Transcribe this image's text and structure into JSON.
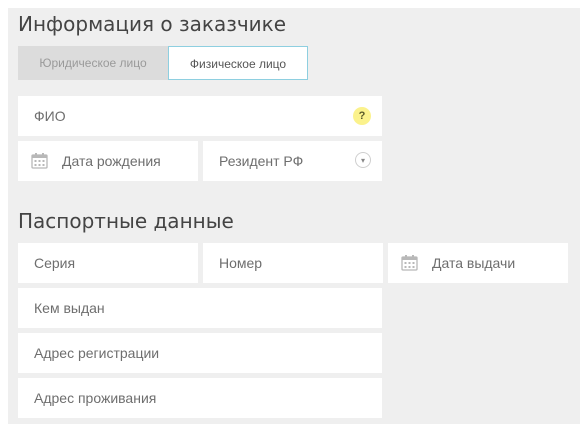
{
  "customer": {
    "title": "Информация о заказчике",
    "tabs": [
      {
        "label": "Юридическое лицо",
        "active": false
      },
      {
        "label": "Физическое лицо",
        "active": true
      }
    ],
    "full_name_placeholder": "ФИО",
    "help_glyph": "?",
    "birth_date_placeholder": "Дата рождения",
    "resident_label": "Резидент РФ",
    "dropdown_glyph": "▾"
  },
  "passport": {
    "title": "Паспортные данные",
    "series_placeholder": "Серия",
    "number_placeholder": "Номер",
    "issue_date_placeholder": "Дата выдачи",
    "issued_by_placeholder": "Кем выдан",
    "registration_address_placeholder": "Адрес регистрации",
    "residence_address_placeholder": "Адрес проживания"
  },
  "icons": {
    "calendar": "calendar-icon",
    "help": "help-icon",
    "dropdown": "chevron-down-icon"
  },
  "colors": {
    "background": "#efefef",
    "field": "#ffffff",
    "active_tab_border": "#8ecfe0",
    "inactive_tab": "#dcdcdc",
    "help_badge": "#fbf28c"
  }
}
